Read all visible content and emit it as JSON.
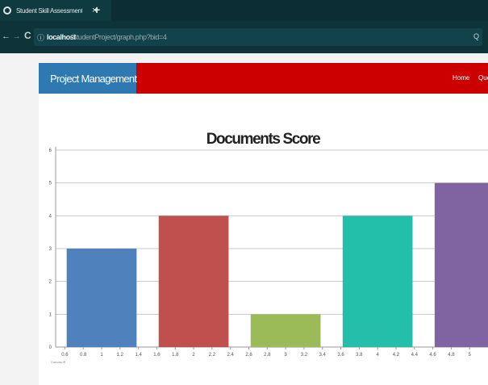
{
  "browser": {
    "tab_title": "Student Skill Assessment",
    "tab_close": "×",
    "new_tab": "+",
    "back": "←",
    "forward": "→",
    "reload": "C",
    "info_icon": "ⓘ",
    "url_host": "localhost",
    "url_path": "/StudentProject/graph.php?bid=4",
    "search_icon": "Q"
  },
  "navbar": {
    "brand": "Project Management",
    "home": "Home",
    "query": "Query"
  },
  "chart_data": {
    "type": "bar",
    "title": "Documents Score",
    "xlabel": "",
    "ylabel": "",
    "ylim": [
      0,
      6
    ],
    "yticks": [
      "0",
      "1",
      "2",
      "3",
      "4",
      "5",
      "6"
    ],
    "categories": [
      "1",
      "2",
      "3",
      "4",
      "5"
    ],
    "values": [
      3,
      4,
      1,
      4,
      5
    ],
    "colors": [
      "#4f81bd",
      "#c0504d",
      "#9bbb59",
      "#23bfaa",
      "#8064a2"
    ],
    "xtick_labels": [
      "0.6",
      "0.8",
      "1",
      "1.2",
      "1.4",
      "1.6",
      "1.8",
      "2",
      "2.2",
      "2.4",
      "2.6",
      "2.8",
      "3",
      "3.2",
      "3.4",
      "3.6",
      "3.8",
      "4",
      "4.2",
      "4.4",
      "4.6",
      "4.8",
      "5"
    ],
    "xlim": [
      0.5,
      5.2
    ],
    "credit": "CanvasJS",
    "grid": true
  }
}
